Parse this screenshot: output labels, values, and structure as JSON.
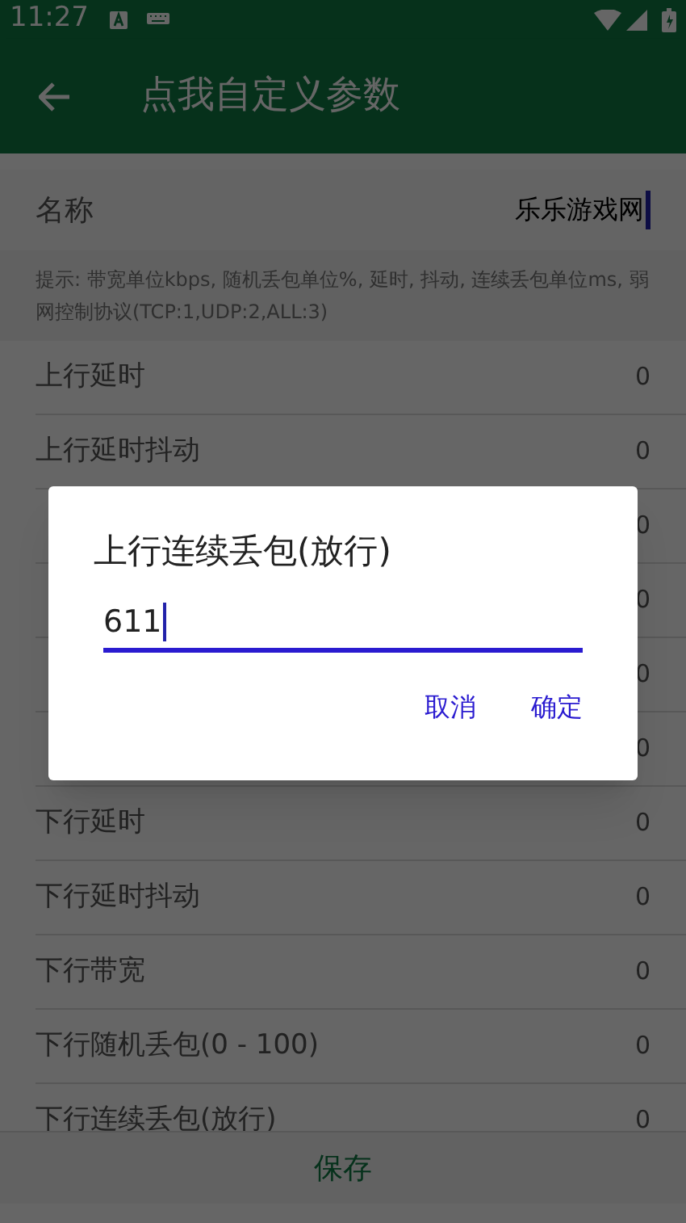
{
  "status_bar": {
    "time": "11:27"
  },
  "app_bar": {
    "title": "点我自定义参数"
  },
  "name_field": {
    "label": "名称",
    "value": "乐乐游戏网"
  },
  "hint": "提示: 带宽单位kbps, 随机丢包单位%, 延时, 抖动, 连续丢包单位ms, 弱网控制协议(TCP:1,UDP:2,ALL:3)",
  "rows": [
    {
      "label": "上行延时",
      "value": "0"
    },
    {
      "label": "上行延时抖动",
      "value": "0"
    },
    {
      "value": "0"
    },
    {
      "value": "0"
    },
    {
      "value": "0"
    },
    {
      "value": "0"
    },
    {
      "label": "下行延时",
      "value": "0"
    },
    {
      "label": "下行延时抖动",
      "value": "0"
    },
    {
      "label": "下行带宽",
      "value": "0"
    },
    {
      "label": "下行随机丢包(0 - 100)",
      "value": "0"
    },
    {
      "label": "下行连续丢包(放行)",
      "value": "0"
    }
  ],
  "save_button": "保存",
  "dialog": {
    "title": "上行连续丢包(放行)",
    "value": "611",
    "buttons": [
      "取消",
      "确定"
    ]
  }
}
